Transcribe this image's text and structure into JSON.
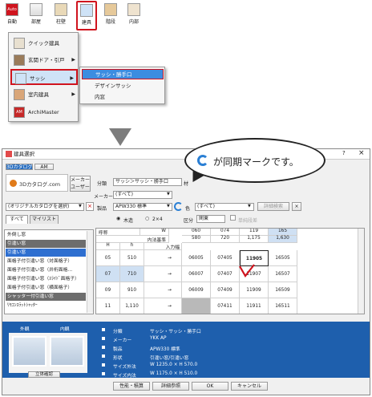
{
  "toolbar": {
    "items": [
      {
        "label": "自動",
        "icon": "auto-icon",
        "badge": "Auto"
      },
      {
        "label": "部屋",
        "icon": "room-icon"
      },
      {
        "label": "柱壁",
        "icon": "column-wall-icon"
      },
      {
        "label": "建具",
        "icon": "fitting-icon",
        "selected": true
      },
      {
        "label": "階段",
        "icon": "stairs-icon"
      },
      {
        "label": "内部",
        "icon": "interior-icon"
      }
    ]
  },
  "menu": {
    "items": [
      {
        "label": "クイック建具",
        "icon": "quick-fitting-icon"
      },
      {
        "label": "玄関ドア・引戸",
        "icon": "entrance-door-icon",
        "submenu": true
      },
      {
        "label": "サッシ",
        "icon": "sash-icon",
        "submenu": true,
        "highlighted": true
      },
      {
        "label": "室内建具",
        "icon": "interior-door-icon",
        "submenu": true
      },
      {
        "label": "ArchiMaster",
        "icon": "archimaster-icon",
        "badge": "AM"
      }
    ],
    "submenu": [
      "サッシ・勝手口",
      "デザインサッシ",
      "内窓"
    ]
  },
  "callout": {
    "text": "が同期マークです。"
  },
  "dialog": {
    "title": "建具選択",
    "logo_tabs": [
      "3Dカタログ",
      "AM"
    ],
    "catalog_logo": "3Dカタログ.com",
    "maker_user_btn": "メーカー\nユーザー",
    "fields": {
      "bunrui_label": "分類",
      "bunrui_value": "サッシ＞サッシ・勝手口",
      "material_label": "材",
      "maker_label": "メーカー",
      "maker_value": "(すべて)",
      "product_label": "製品",
      "product_value": "APW330 標準",
      "color_label": "色",
      "color_value": "(すべて)",
      "detail_btn": "詳細検索",
      "catalog_select": "(オリジナルカタログを選択)"
    },
    "tabs": [
      "すべて",
      "マイリスト"
    ],
    "structure": {
      "wood": "木造",
      "steel": "2×4",
      "kubun_label": "区分",
      "kubun_value": "関東",
      "single_label": "単純段差"
    },
    "list": [
      {
        "label": "外倒し窓",
        "type": "item"
      },
      {
        "label": "引違い窓",
        "type": "group"
      },
      {
        "label": "引違い窓",
        "type": "selected"
      },
      {
        "label": "面格子付引違い窓（対面格子）",
        "type": "item"
      },
      {
        "label": "面格子付引違い窓（井桁面格…",
        "type": "item"
      },
      {
        "label": "面格子付引違い窓（ｽﾗｲﾄﾞ面格子）",
        "type": "item"
      },
      {
        "label": "面格子付引違い窓（横面格子）",
        "type": "item"
      },
      {
        "label": "シャッター付引違い窓",
        "type": "group"
      },
      {
        "label": "ﾘﾓｺﾝｽﾗｯﾄｼｬｯﾀｰ",
        "type": "item"
      }
    ],
    "grid": {
      "h_code": "呼称",
      "h_w": "W",
      "h_inner": "内法基準",
      "h_H": "H",
      "h_h": "h",
      "h_width": "入力幅",
      "cols": [
        "060",
        "074",
        "119",
        "165"
      ],
      "widths": [
        "580",
        "720",
        "1,175",
        "1,630"
      ],
      "rows": [
        {
          "code": "05",
          "h": "510",
          "w": "→",
          "cells": [
            "06005",
            "07405",
            "11905",
            "16505"
          ]
        },
        {
          "code": "07",
          "h": "710",
          "w": "→",
          "cells": [
            "06007",
            "07407",
            "11907",
            "16507"
          ]
        },
        {
          "code": "09",
          "h": "910",
          "w": "→",
          "cells": [
            "06009",
            "07409",
            "11909",
            "16509"
          ]
        },
        {
          "code": "11",
          "h": "1,110",
          "w": "→",
          "cells": [
            "",
            "07411",
            "11911",
            "16511"
          ]
        }
      ]
    },
    "preview": {
      "outer": "外観",
      "inner": "内観",
      "confirm": "立体確認"
    },
    "info": [
      {
        "label": "分類",
        "value": "サッシ・サッシ・勝手口"
      },
      {
        "label": "メーカー",
        "value": "YKK AP"
      },
      {
        "label": "製品",
        "value": "APW330 標準"
      },
      {
        "label": "形状",
        "value": "引違い窓/引違い窓"
      },
      {
        "label": "サイズ外法",
        "value": "W 1235.0 × H 570.0"
      },
      {
        "label": "サイズ内法",
        "value": "W 1175.0 × H 510.0"
      }
    ],
    "buttons": [
      "性能・積算",
      "詳細参照",
      "OK",
      "キャンセル"
    ]
  },
  "colors": {
    "accent_red": "#d0141e",
    "blue": "#1e5fad",
    "selected_blue": "#2e6fd0"
  }
}
